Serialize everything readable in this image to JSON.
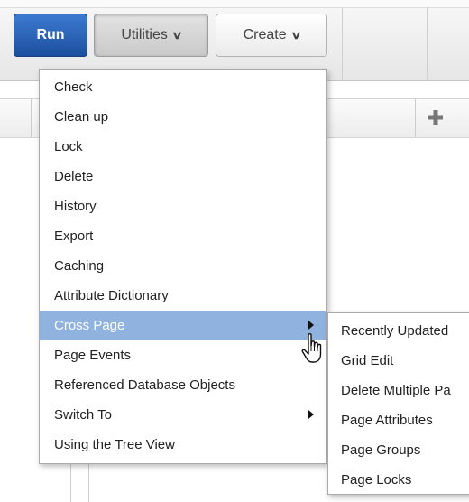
{
  "toolbar": {
    "run_label": "Run",
    "utilities_label": "Utilities",
    "create_label": "Create"
  },
  "icons": {
    "chevron": "chevron-down-icon",
    "add": "plus-icon",
    "submenu_arrow": "caret-right-icon",
    "cursor": "hand-pointer-cursor"
  },
  "colors": {
    "run_button": "#1c4f9f",
    "menu_highlight": "#8fb2de",
    "add_icon": "#777777"
  },
  "utilities_menu": {
    "items": [
      {
        "label": "Check"
      },
      {
        "label": "Clean up"
      },
      {
        "label": "Lock"
      },
      {
        "label": "Delete"
      },
      {
        "label": "History"
      },
      {
        "label": "Export"
      },
      {
        "label": "Caching"
      },
      {
        "label": "Attribute Dictionary"
      },
      {
        "label": "Cross Page",
        "active": true,
        "has_submenu": true
      },
      {
        "label": "Page Events"
      },
      {
        "label": "Referenced Database Objects"
      },
      {
        "label": "Switch To",
        "has_submenu": true
      },
      {
        "label": "Using the Tree View"
      }
    ]
  },
  "cross_page_submenu": {
    "items": [
      {
        "label": "Recently Updated"
      },
      {
        "label": "Grid Edit"
      },
      {
        "label": "Delete Multiple Pa"
      },
      {
        "label": "Page Attributes"
      },
      {
        "label": "Page Groups"
      },
      {
        "label": "Page Locks"
      }
    ]
  }
}
